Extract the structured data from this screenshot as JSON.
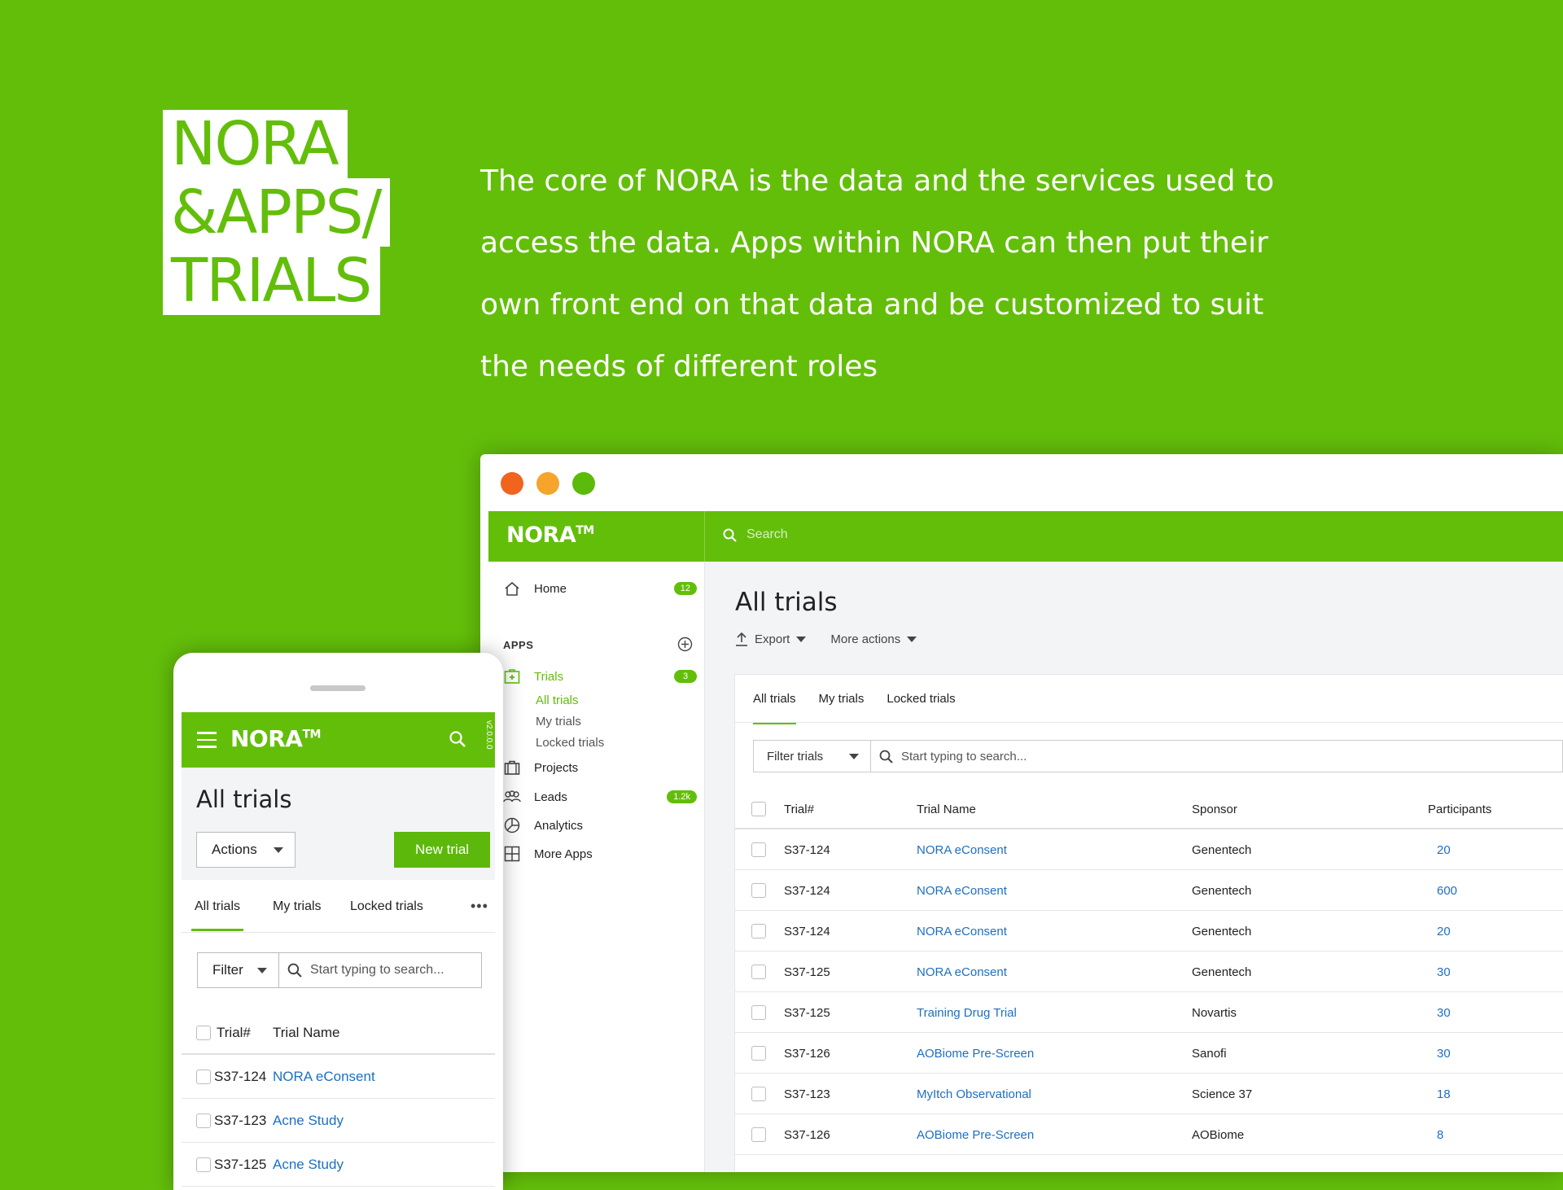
{
  "hero": {
    "title_lines": [
      "NORA",
      "&APPS/",
      "TRIALS"
    ],
    "description": "The core of NORA is the data and the services used to access the data. Apps within NORA can then put their own front end on that data and be customized to suit the needs of different roles"
  },
  "colors": {
    "brand_green": "#63be0a",
    "link_blue": "#1d6fc4",
    "dot_red": "#f0641e",
    "dot_yellow": "#f5a42c",
    "dot_green": "#5cbb0a"
  },
  "desktop": {
    "brand": "NORA",
    "brand_tm": "TM",
    "search_placeholder": "Search",
    "sidebar": {
      "home": {
        "label": "Home",
        "badge": "12",
        "icon": "home-icon"
      },
      "apps_label": "APPS",
      "trials": {
        "label": "Trials",
        "badge": "3",
        "icon": "medical-kit-icon"
      },
      "sub": [
        "All trials",
        "My trials",
        "Locked trials"
      ],
      "projects": {
        "label": "Projects",
        "icon": "briefcase-icon"
      },
      "leads": {
        "label": "Leads",
        "badge": "1.2k",
        "icon": "users-icon"
      },
      "analytics": {
        "label": "Analytics",
        "icon": "pie-chart-icon"
      },
      "more_apps": {
        "label": "More Apps",
        "icon": "grid-icon"
      }
    },
    "main": {
      "title": "All trials",
      "export_label": "Export",
      "more_actions_label": "More actions",
      "tabs": [
        "All trials",
        "My trials",
        "Locked trials"
      ],
      "filter_label": "Filter trials",
      "search_placeholder": "Start typing to search...",
      "columns": [
        "Trial#",
        "Trial Name",
        "Sponsor",
        "Participants"
      ],
      "rows": [
        [
          "S37-124",
          "NORA eConsent",
          "Genentech",
          "20"
        ],
        [
          "S37-124",
          "NORA eConsent",
          "Genentech",
          "600"
        ],
        [
          "S37-124",
          "NORA eConsent",
          "Genentech",
          "20"
        ],
        [
          "S37-125",
          "NORA eConsent",
          "Genentech",
          "30"
        ],
        [
          "S37-125",
          "Training Drug Trial",
          "Novartis",
          "30"
        ],
        [
          "S37-126",
          "AOBiome Pre-Screen",
          "Sanofi",
          "30"
        ],
        [
          "S37-123",
          "MyItch Observational",
          "Science 37",
          "18"
        ],
        [
          "S37-126",
          "AOBiome Pre-Screen",
          "AOBiome",
          "8"
        ]
      ]
    }
  },
  "mobile": {
    "brand": "NORA",
    "brand_tm": "TM",
    "version": "v2.0.0.0",
    "title": "All trials",
    "actions_label": "Actions",
    "new_trial_label": "New trial",
    "tabs": [
      "All trials",
      "My trials",
      "Locked trials"
    ],
    "more_label": "•••",
    "filter_label": "Filter",
    "search_placeholder": "Start typing to search...",
    "columns": [
      "Trial#",
      "Trial Name"
    ],
    "rows": [
      [
        "S37-124",
        "NORA eConsent"
      ],
      [
        "S37-123",
        "Acne Study"
      ],
      [
        "S37-125",
        "Acne Study"
      ]
    ]
  }
}
